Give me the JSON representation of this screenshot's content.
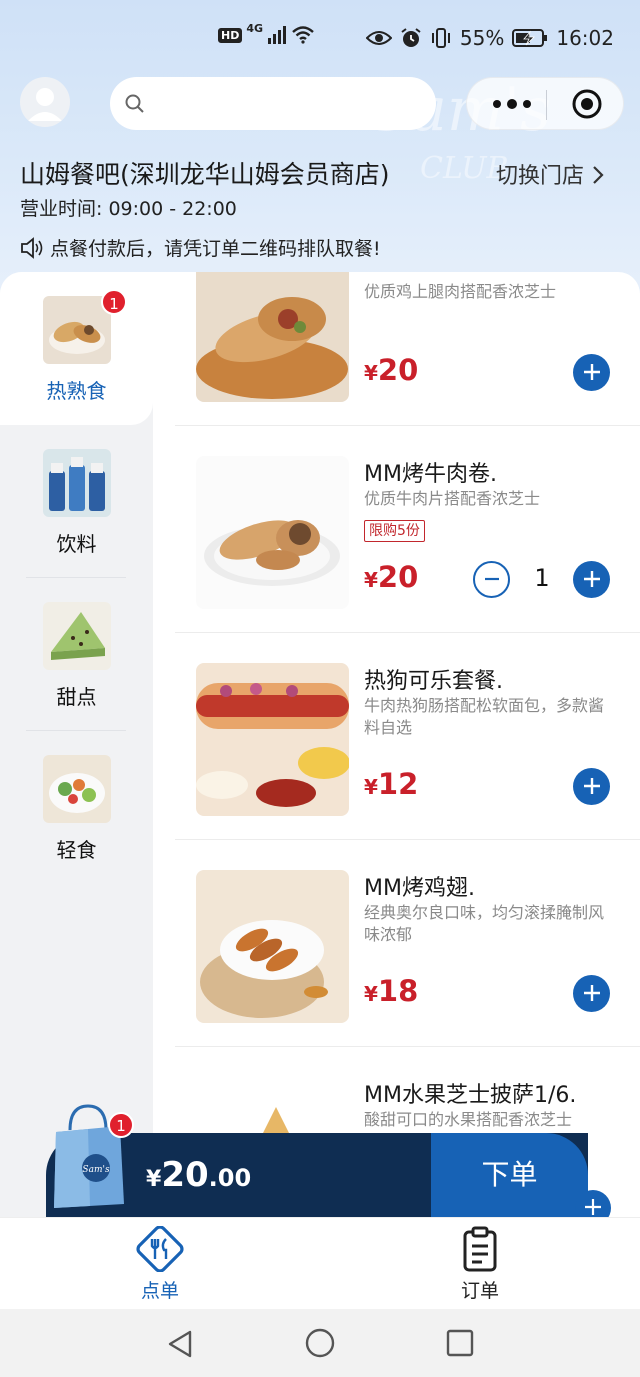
{
  "status_bar": {
    "hd": "HD",
    "network": "4G",
    "battery": "55%",
    "time": "16:02"
  },
  "header": {
    "search_placeholder": "",
    "store_name": "山姆餐吧(深圳龙华山姆会员商店)",
    "switch_store": "切换门店",
    "hours": "营业时间: 09:00 - 22:00",
    "notice": "点餐付款后，请凭订单二维码排队取餐!"
  },
  "categories": [
    {
      "label": "热熟食",
      "badge": "1",
      "active": true
    },
    {
      "label": "饮料"
    },
    {
      "label": "甜点"
    },
    {
      "label": "轻食"
    }
  ],
  "items": [
    {
      "name": "",
      "desc": "优质鸡上腿肉搭配香浓芝士",
      "price_currency": "¥",
      "price": "20"
    },
    {
      "name": "MM烤牛肉卷.",
      "desc": "优质牛肉片搭配香浓芝士",
      "limit_tag": "限购5份",
      "price_currency": "¥",
      "price": "20",
      "qty": "1"
    },
    {
      "name": "热狗可乐套餐.",
      "desc": "牛肉热狗肠搭配松软面包，多款酱料自选",
      "price_currency": "¥",
      "price": "12"
    },
    {
      "name": "MM烤鸡翅.",
      "desc": "经典奥尔良口味，均匀滚揉腌制风味浓郁",
      "price_currency": "¥",
      "price": "18"
    },
    {
      "name": "MM水果芝士披萨1/6.",
      "desc": "酸甜可口的水果搭配香浓芝士"
    }
  ],
  "cart": {
    "badge": "1",
    "currency": "¥",
    "total_int": "20",
    "total_dec": ".00",
    "order_button": "下单"
  },
  "tabbar": {
    "tabs": [
      {
        "label": "点单",
        "active": true
      },
      {
        "label": "订单"
      }
    ]
  },
  "colors": {
    "accent": "#1762b5",
    "price": "#c9202a",
    "cart_bar": "#0f2d52",
    "badge": "#e0202d"
  }
}
